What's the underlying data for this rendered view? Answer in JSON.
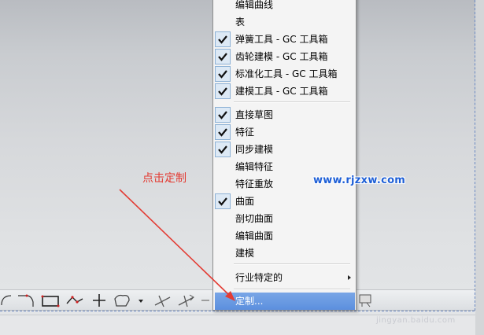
{
  "menu": {
    "items": [
      {
        "label": "编辑曲线",
        "checked": false
      },
      {
        "label": "表",
        "checked": false
      },
      {
        "label": "弹簧工具 - GC 工具箱",
        "checked": true
      },
      {
        "label": "齿轮建模 - GC 工具箱",
        "checked": true
      },
      {
        "label": "标准化工具 - GC 工具箱",
        "checked": true
      },
      {
        "label": "建模工具 - GC 工具箱",
        "checked": true
      },
      {
        "label": "直接草图",
        "checked": true
      },
      {
        "label": "特征",
        "checked": true
      },
      {
        "label": "同步建模",
        "checked": true
      },
      {
        "label": "编辑特征",
        "checked": false
      },
      {
        "label": "特征重放",
        "checked": false
      },
      {
        "label": "曲面",
        "checked": true
      },
      {
        "label": "剖切曲面",
        "checked": false
      },
      {
        "label": "编辑曲面",
        "checked": false
      },
      {
        "label": "建模",
        "checked": false
      },
      {
        "label": "行业特定的",
        "checked": false,
        "submenu": true
      },
      {
        "label": "定制...",
        "checked": false,
        "highlighted": true
      }
    ]
  },
  "annotation": {
    "text": "点击定制",
    "color": "#e33b33"
  },
  "watermark": {
    "site": "www.rjzxw.com",
    "bottom": "jingyan.baidu.com"
  },
  "toolbar": {
    "icons": [
      "arc-icon",
      "fillet-icon",
      "rectangle-icon",
      "polyline-icon",
      "point-icon",
      "polygon-icon",
      "dropdown-icon",
      "trim-icon",
      "extend-icon",
      "constraint-icon",
      "sketch-icon"
    ]
  },
  "colors": {
    "highlight": "#5c8fde",
    "check_box": "#dde9f5",
    "arrow": "#e33b33"
  }
}
